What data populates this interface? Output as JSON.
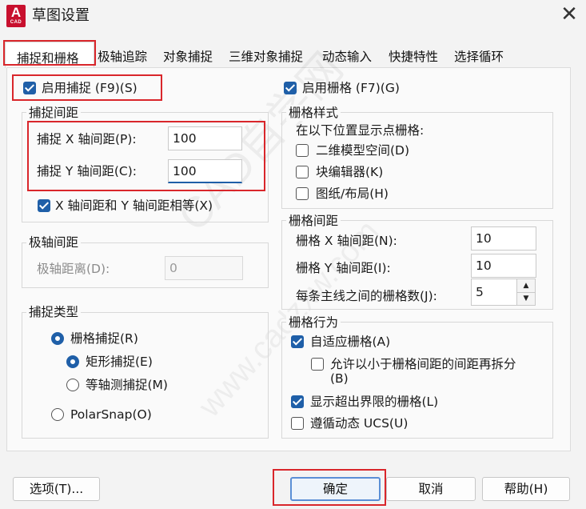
{
  "window": {
    "title": "草图设置",
    "icon_letter": "A",
    "icon_sub": "CAD"
  },
  "tabs": [
    "捕捉和栅格",
    "极轴追踪",
    "对象捕捉",
    "三维对象捕捉",
    "动态输入",
    "快捷特性",
    "选择循环"
  ],
  "snap_on": {
    "label": "启用捕捉 (F9)(S)",
    "checked": true
  },
  "grid_on": {
    "label": "启用栅格 (F7)(G)",
    "checked": true
  },
  "snap_spacing": {
    "title": "捕捉间距",
    "x_label": "捕捉 X 轴间距(P):",
    "x_value": "100",
    "y_label": "捕捉 Y 轴间距(C):",
    "y_value": "100",
    "equal_label": "X 轴间距和 Y 轴间距相等(X)"
  },
  "polar_spacing": {
    "title": "极轴间距",
    "label": "极轴距离(D):",
    "value": "0"
  },
  "snap_type": {
    "title": "捕捉类型",
    "grid_snap": "栅格捕捉(R)",
    "rect_snap": "矩形捕捉(E)",
    "iso_snap": "等轴测捕捉(M)",
    "polar_snap": "PolarSnap(O)"
  },
  "grid_style": {
    "title": "栅格样式",
    "desc": "在以下位置显示点栅格:",
    "model_space": "二维模型空间(D)",
    "block_editor": "块编辑器(K)",
    "sheet_layout": "图纸/布局(H)"
  },
  "grid_spacing": {
    "title": "栅格间距",
    "x_label": "栅格 X 轴间距(N):",
    "x_value": "10",
    "y_label": "栅格 Y 轴间距(I):",
    "y_value": "10",
    "major_label": "每条主线之间的栅格数(J):",
    "major_value": "5"
  },
  "grid_behavior": {
    "title": "栅格行为",
    "adaptive": "自适应栅格(A)",
    "subdivide_line1": "允许以小于栅格间距的间距再拆分",
    "subdivide_line2": "(B)",
    "beyond_limits": "显示超出界限的栅格(L)",
    "follow_ucs": "遵循动态 UCS(U)"
  },
  "buttons": {
    "options": "选项(T)...",
    "ok": "确定",
    "cancel": "取消",
    "help": "帮助(H)"
  },
  "watermark": {
    "main": "CAD自学网",
    "url": "www.cadzxw.com"
  },
  "colors": {
    "accent": "#1f5fa8",
    "highlight_red": "#d9262b"
  }
}
